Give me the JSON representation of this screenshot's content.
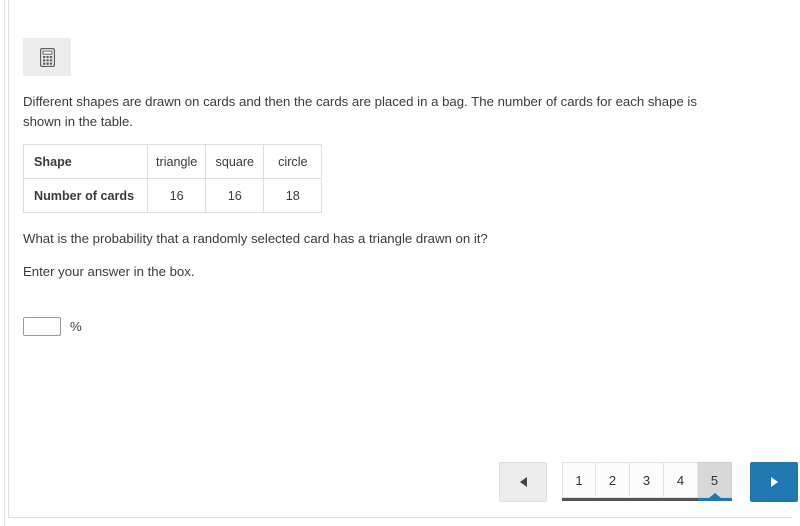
{
  "tools": {
    "calculator_label": "Calculator",
    "calculator_icon": "calculator-icon"
  },
  "question": {
    "intro": "Different shapes are drawn on cards and then the cards are placed in a bag. The number of cards for each shape is shown in the table.",
    "question_text": "What is the probability that a randomly selected card has a triangle drawn on it?",
    "instruction": "Enter your answer in the box."
  },
  "table": {
    "row_labels": [
      "Shape",
      "Number of cards"
    ],
    "shapes": [
      "triangle",
      "square",
      "circle"
    ],
    "counts": [
      "16",
      "16",
      "18"
    ]
  },
  "answer": {
    "value": "",
    "placeholder": "",
    "unit": "%"
  },
  "pagination": {
    "prev_icon": "triangle-left-icon",
    "next_icon": "triangle-right-icon",
    "pages": [
      "1",
      "2",
      "3",
      "4",
      "5"
    ],
    "active_page": "5",
    "accent_color": "#1f79b0"
  }
}
